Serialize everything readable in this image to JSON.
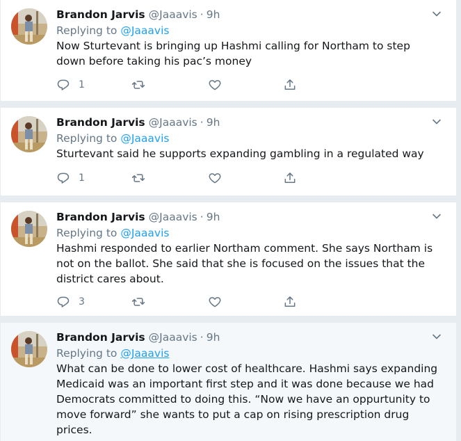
{
  "colors": {
    "accent": "#1da1f2",
    "secondary_text": "#657786",
    "primary_text": "#14171a",
    "separator": "#e6ecf0",
    "hover_bg": "#f5f8fa"
  },
  "tweets": [
    {
      "name": "Brandon Jarvis",
      "handle": "@Jaaavis",
      "separator": "·",
      "time": "9h",
      "reply_prefix": "Replying to",
      "reply_mention": "@Jaaavis",
      "text": "Now Sturtevant is bringing up Hashmi calling for Northam to step down before taking his pac’s money",
      "reply_count": "1",
      "icons": [
        "avatar-photo",
        "chevron-down-icon",
        "reply-icon",
        "retweet-icon",
        "heart-icon",
        "share-icon"
      ]
    },
    {
      "name": "Brandon Jarvis",
      "handle": "@Jaaavis",
      "separator": "·",
      "time": "9h",
      "reply_prefix": "Replying to",
      "reply_mention": "@Jaaavis",
      "text": "Sturtevant said he supports expanding gambling in a regulated way",
      "reply_count": "1"
    },
    {
      "name": "Brandon Jarvis",
      "handle": "@Jaaavis",
      "separator": "·",
      "time": "9h",
      "reply_prefix": "Replying to",
      "reply_mention": "@Jaaavis",
      "text": "Hashmi responded to earlier Northam comment. She says Northam is not on the ballot. She said that she is focused on the issues that the district cares about.",
      "reply_count": "3"
    },
    {
      "name": "Brandon Jarvis",
      "handle": "@Jaaavis",
      "separator": "·",
      "time": "9h",
      "reply_prefix": "Replying to",
      "reply_mention": "@Jaaavis",
      "text": "What can be done to lower cost of healthcare. Hashmi says expanding Medicaid was an important first step and it was done because we had Democrats committed to doing this. “Now we have an oppurtunity to move forward” she wants to put a cap on rising prescription drug prices.",
      "reply_count": ""
    }
  ]
}
